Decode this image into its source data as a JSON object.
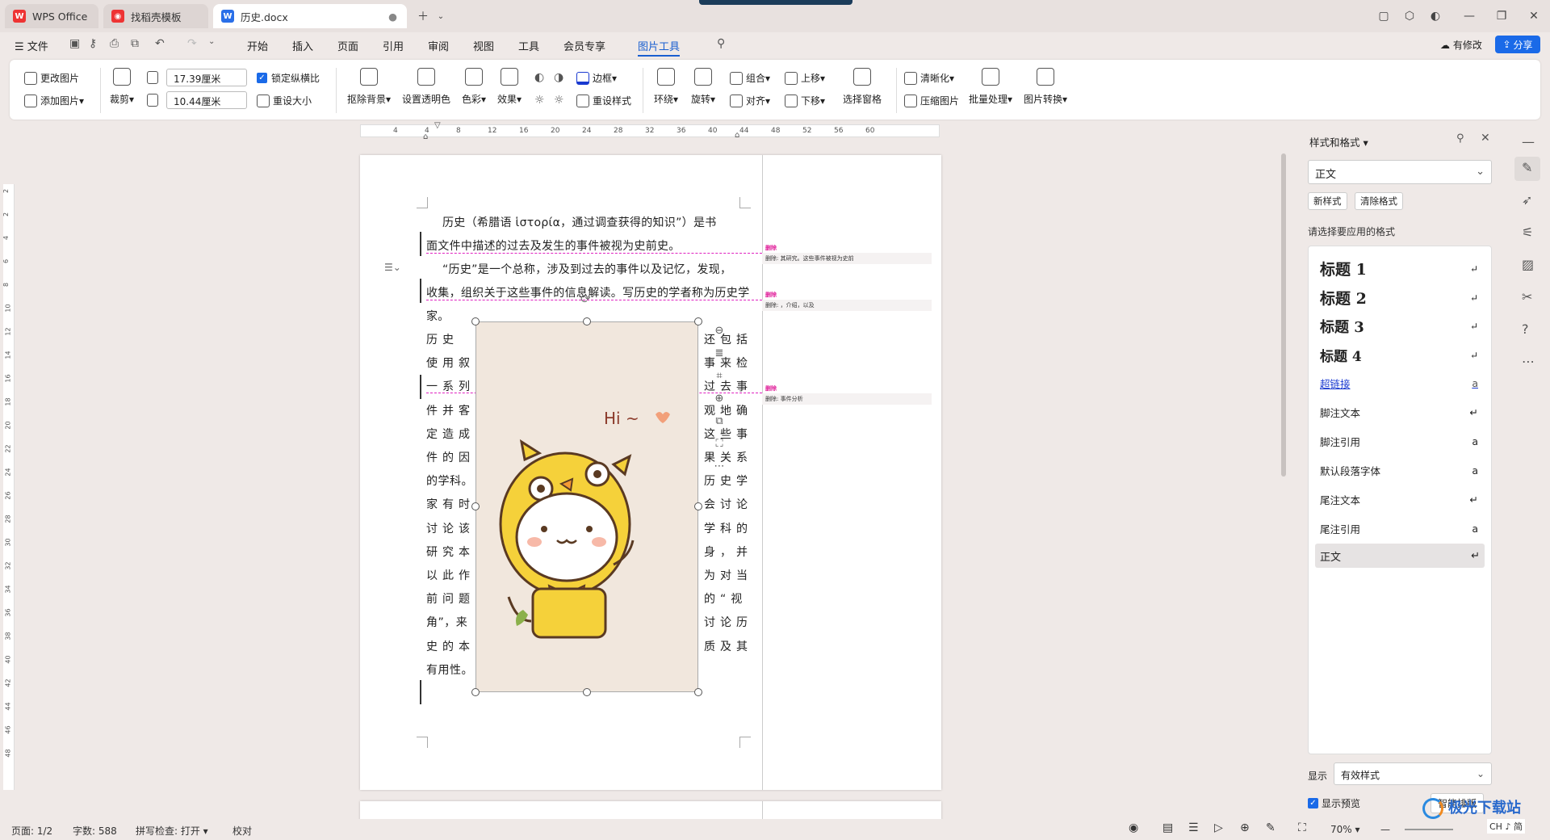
{
  "tabs": [
    {
      "label": "WPS Office"
    },
    {
      "label": "找稻壳模板"
    },
    {
      "label": "历史.docx"
    }
  ],
  "menu": {
    "file": "文件",
    "items": [
      "开始",
      "插入",
      "页面",
      "引用",
      "审阅",
      "视图",
      "工具",
      "会员专享",
      "图片工具"
    ],
    "active": "图片工具",
    "revise": "有修改",
    "share": "分享"
  },
  "ribbon": {
    "change_picture": "更改图片",
    "add_picture": "添加图片",
    "crop": "裁剪",
    "width": "17.39厘米",
    "height": "10.44厘米",
    "lock_ratio": "锁定纵横比",
    "reset_size": "重设大小",
    "remove_bg": "抠除背景",
    "set_transparent": "设置透明色",
    "color": "色彩",
    "effect": "效果",
    "border": "边框",
    "reset_style": "重设样式",
    "wrap": "环绕",
    "rotate": "旋转",
    "group": "组合",
    "align": "对齐",
    "move_up": "上移",
    "move_down": "下移",
    "selection_pane": "选择窗格",
    "sharpen": "清晰化",
    "compress": "压缩图片",
    "batch": "批量处理",
    "convert": "图片转换"
  },
  "ruler": {
    "ticks": [
      "4",
      "4",
      "8",
      "12",
      "16",
      "20",
      "24",
      "28",
      "32",
      "36",
      "40",
      "44",
      "48",
      "52",
      "56",
      "60"
    ],
    "left_ticks": [
      "2",
      "2",
      "4",
      "6",
      "8",
      "10",
      "12",
      "14",
      "16",
      "18",
      "20",
      "22",
      "24",
      "26",
      "28",
      "30",
      "32",
      "34",
      "36",
      "38",
      "40",
      "42",
      "44",
      "46",
      "48"
    ]
  },
  "doc": {
    "line1": "历史（希腊语 ἱστορία，通过调查获得的知识”）是书",
    "line2": "面文件中描述的过去及发生的事件被视为史前史。",
    "line3": "“历史”是一个总称，涉及到过去的事件以及记忆，发现，",
    "line4": "收集，组织关于这些事件的信息解读。写历史的学者称为历史学",
    "line5": "家。",
    "left_col": [
      "历史",
      "使用叙",
      "一系列",
      "件并客",
      "定造成",
      "件的因",
      "的学科。",
      "家有时",
      "讨论该",
      "研究本",
      "以此作",
      "前问题",
      "角”，来",
      "史的本",
      "有用性。"
    ],
    "right_col": [
      "还包括",
      "事来检",
      "过去事",
      "观地确",
      "这些事",
      "果关系",
      "历史学",
      "会讨论",
      "学科的",
      "身，并",
      "为对当",
      "的“视",
      "讨论历",
      "质及其"
    ]
  },
  "image": {
    "caption": "Hi ~"
  },
  "comments": [
    {
      "tag": "删除",
      "text": "删除: 其研究。这些事件被视为史前"
    },
    {
      "tag": "删除",
      "text": "删除: ，介绍，以及"
    },
    {
      "tag": "删除",
      "text": "删除: 事件分析"
    }
  ],
  "panel": {
    "title": "样式和格式",
    "current": "正文",
    "new_style": "新样式",
    "clear": "清除格式",
    "prompt": "请选择要应用的格式",
    "styles": [
      {
        "name": "标题 1"
      },
      {
        "name": "标题 2"
      },
      {
        "name": "标题 3"
      },
      {
        "name": "标题 4"
      },
      {
        "name": "超链接"
      },
      {
        "name": "脚注文本"
      },
      {
        "name": "脚注引用"
      },
      {
        "name": "默认段落字体"
      },
      {
        "name": "尾注文本"
      },
      {
        "name": "尾注引用"
      },
      {
        "name": "正文"
      }
    ],
    "show_label": "显示",
    "show_value": "有效样式",
    "preview": "显示预览",
    "smart": "智能排版"
  },
  "status": {
    "page": "页面: 1/2",
    "words": "字数: 588",
    "spell": "拼写检查: 打开",
    "proof": "校对",
    "zoom": "70%"
  },
  "watermark": "极光下载站",
  "ime": "CH ♪ 简"
}
